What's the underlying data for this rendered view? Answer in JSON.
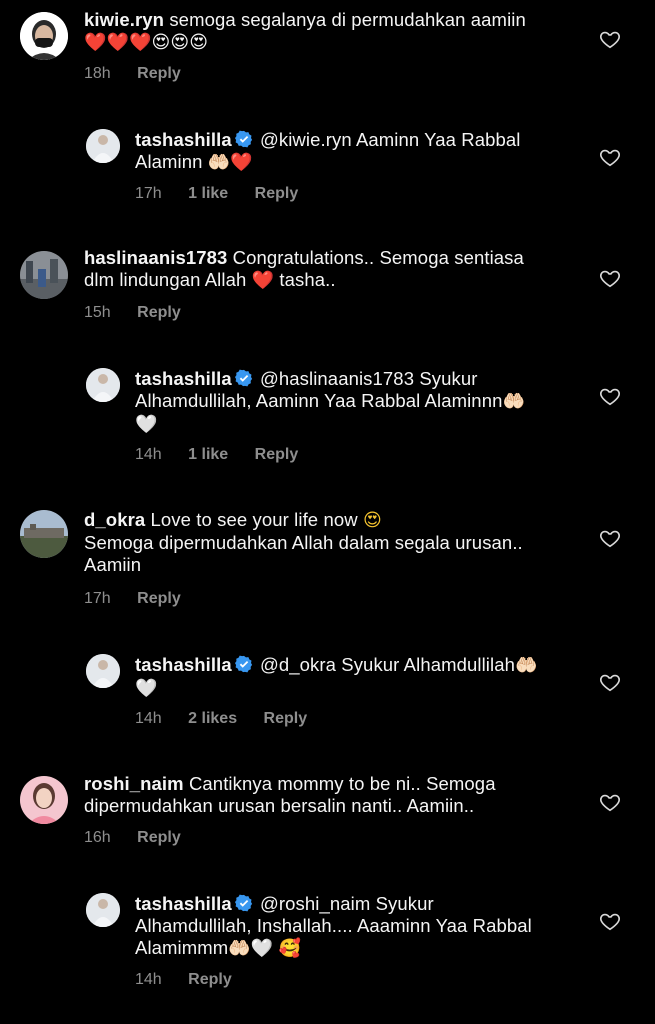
{
  "comments": [
    {
      "username": "kiwie.ryn",
      "text": "semoga segalanya di permudahkan aamiin",
      "emojis_line2": "❤️❤️❤️😍😍😍",
      "time": "18h",
      "reply": "Reply"
    },
    {
      "username": "tashashilla",
      "text_line1": "@kiwie.ryn Aaminn Yaa Rabbal",
      "text_line2": "Alaminn",
      "emojis": "🤲🏻❤️",
      "time": "17h",
      "likes": "1 like",
      "reply": "Reply"
    },
    {
      "username": "haslinaanis1783",
      "text_line1": "Congratulations.. Semoga sentiasa",
      "text_line2a": "dlm lindungan Allah",
      "text_line2b": "tasha..",
      "time": "15h",
      "reply": "Reply"
    },
    {
      "username": "tashashilla",
      "text_line1": "@haslinaanis1783 Syukur",
      "text_line2": "Alhamdullilah,  Aaminn Yaa Rabbal Alaminnn",
      "time": "14h",
      "likes": "1 like",
      "reply": "Reply"
    },
    {
      "username": "d_okra",
      "text_line1": "Love to see your life now",
      "text_line2": "Semoga dipermudahkan Allah dalam segala urusan..",
      "text_line3": "Aamiin",
      "time": "17h",
      "reply": "Reply"
    },
    {
      "username": "tashashilla",
      "text_line1": "@d_okra  Syukur Alhamdullilah",
      "time": "14h",
      "likes": "2 likes",
      "reply": "Reply"
    },
    {
      "username": "roshi_naim",
      "text_line1": "Cantiknya mommy to be ni.. Semoga",
      "text_line2": "dipermudahkan urusan bersalin nanti.. Aamiin..",
      "time": "16h",
      "reply": "Reply"
    },
    {
      "username": "tashashilla",
      "text_line1": "@roshi_naim  Syukur",
      "text_line2": "Alhamdullilah, Inshallah.... Aaaminn Yaa Rabbal",
      "text_line3": "Alamimmm",
      "time": "14h",
      "reply": "Reply"
    }
  ],
  "colors": {
    "background": "#000000",
    "meta": "#8e8e8e",
    "verified": "#3897f0",
    "heart_red": "#e8213f"
  }
}
